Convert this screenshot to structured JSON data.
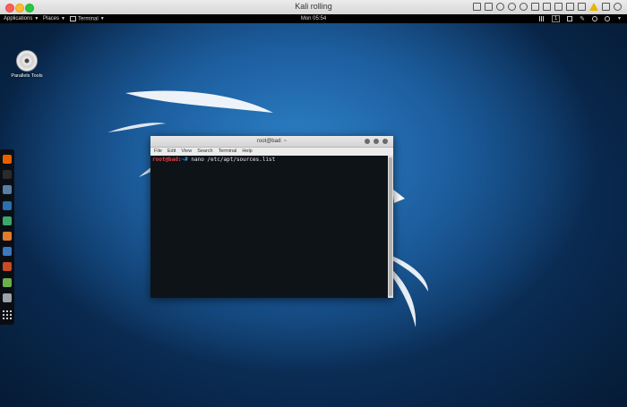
{
  "host": {
    "title": "Kali rolling"
  },
  "panel": {
    "applications": "Applications",
    "places": "Places",
    "terminal": "Terminal",
    "clock": "Mon 05:54",
    "workspace": "1"
  },
  "desktop": {
    "icon_label": "Parallels Tools"
  },
  "dock": {
    "apps": [
      {
        "name": "firefox",
        "color": "#e66000"
      },
      {
        "name": "terminal",
        "color": "#2b2b2b"
      },
      {
        "name": "files",
        "color": "#5a7fa6"
      },
      {
        "name": "metasploit",
        "color": "#2a6fb0"
      },
      {
        "name": "armitage",
        "color": "#3aa66a"
      },
      {
        "name": "burpsuite",
        "color": "#e07a2e"
      },
      {
        "name": "maltego",
        "color": "#3b78c0"
      },
      {
        "name": "beef",
        "color": "#c84b28"
      },
      {
        "name": "leafpad",
        "color": "#6ab04c"
      },
      {
        "name": "faraday",
        "color": "#9aa2aa"
      }
    ]
  },
  "terminal": {
    "title": "root@bad: ~",
    "menu": [
      "File",
      "Edit",
      "View",
      "Search",
      "Terminal",
      "Help"
    ],
    "prompt_user": "root@bad",
    "prompt_path": ":~#",
    "command": " nano /etc/apt/sources.list"
  }
}
